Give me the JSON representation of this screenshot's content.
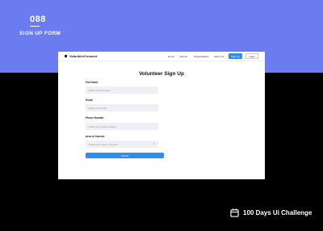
{
  "shot": {
    "number": "088",
    "subtitle": "SIGN UP FORM"
  },
  "nav": {
    "brand": "VolunteerConnect",
    "links": [
      "Home",
      "Events",
      "Organizations",
      "About Us"
    ],
    "signup_label": "Sign Up",
    "login_label": "Login"
  },
  "form": {
    "title": "Volunteer Sign Up",
    "fields": [
      {
        "label": "Full Name",
        "placeholder": "Enter your full name"
      },
      {
        "label": "Email",
        "placeholder": "Enter your email"
      },
      {
        "label": "Phone Number",
        "placeholder": "Enter your phone number"
      },
      {
        "label": "Area of Interest",
        "placeholder": "Select your area of interest"
      }
    ],
    "submit_label": "Submit"
  },
  "footer": {
    "challenge": "100 Days Ui Challenge",
    "icon": "calendar-icon"
  },
  "colors": {
    "accent": "#6b7cf0",
    "primary_button": "#2f8cf0",
    "background": "#000000"
  }
}
